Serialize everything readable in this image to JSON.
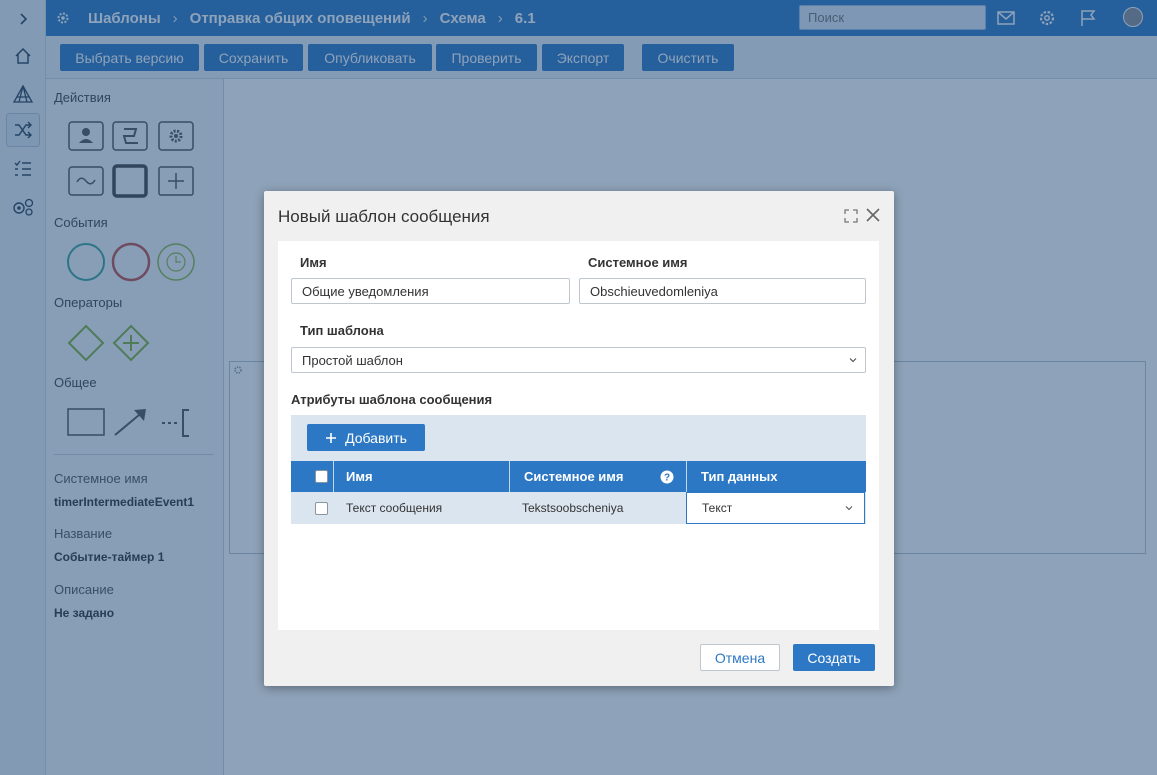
{
  "topbar": {
    "crumbs": [
      "Шаблоны",
      "Отправка общих оповещений",
      "Схема",
      "6.1"
    ],
    "search_placeholder": "Поиск"
  },
  "toolbar": {
    "buttons": [
      "Выбрать версию",
      "Сохранить",
      "Опубликовать",
      "Проверить",
      "Экспорт",
      "Очистить"
    ]
  },
  "palette": {
    "sections": [
      "Действия",
      "События",
      "Операторы",
      "Общее"
    ],
    "properties": [
      {
        "label": "Системное имя",
        "value": "timerIntermediateEvent1"
      },
      {
        "label": "Название",
        "value": "Событие-таймер 1"
      },
      {
        "label": "Описание",
        "value": "Не задано"
      }
    ]
  },
  "modal": {
    "title": "Новый шаблон сообщения",
    "name_label": "Имя",
    "name_value": "Общие уведомления",
    "sysname_label": "Системное имя",
    "sysname_value": "Obschieuvedomleniya",
    "type_label": "Тип шаблона",
    "type_value": "Простой шаблон",
    "attrs_label": "Атрибуты шаблона сообщения",
    "add_label": "Добавить",
    "grid": {
      "columns": [
        "Имя",
        "Системное имя",
        "Тип данных"
      ],
      "rows": [
        {
          "name": "Текст сообщения",
          "sysname": "Tekstsoobscheniya",
          "type": "Текст"
        }
      ]
    },
    "cancel_label": "Отмена",
    "create_label": "Создать"
  },
  "colors": {
    "primary": "#2d78c4",
    "overlay": "#1e4673",
    "event_start": "#3aa59b",
    "event_end": "#c0504d",
    "event_timer": "#8cb84a",
    "gateway": "#7fb33f"
  }
}
